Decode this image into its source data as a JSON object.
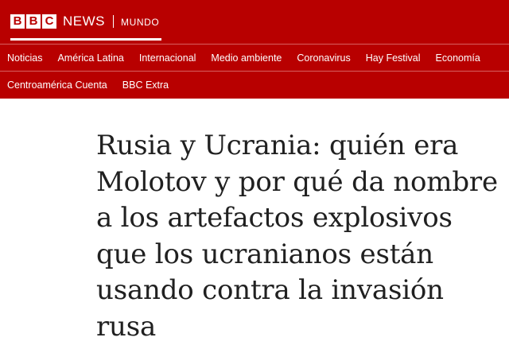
{
  "brand": {
    "logo_letters": [
      "B",
      "B",
      "C"
    ],
    "news": "NEWS",
    "section": "MUNDO",
    "colors": {
      "primary": "#b80000",
      "on_primary": "#ffffff",
      "headline": "#202020"
    }
  },
  "nav": {
    "row1": [
      {
        "label": "Noticias"
      },
      {
        "label": "América Latina"
      },
      {
        "label": "Internacional"
      },
      {
        "label": "Medio ambiente"
      },
      {
        "label": "Coronavirus"
      },
      {
        "label": "Hay Festival"
      },
      {
        "label": "Economía"
      }
    ],
    "row2": [
      {
        "label": "Centroamérica Cuenta"
      },
      {
        "label": "BBC Extra"
      }
    ]
  },
  "article": {
    "headline": "Rusia y Ucrania: quién era Molotov y por qué da nombre a los artefactos explosivos que los ucranianos están usando contra la invasión rusa"
  }
}
